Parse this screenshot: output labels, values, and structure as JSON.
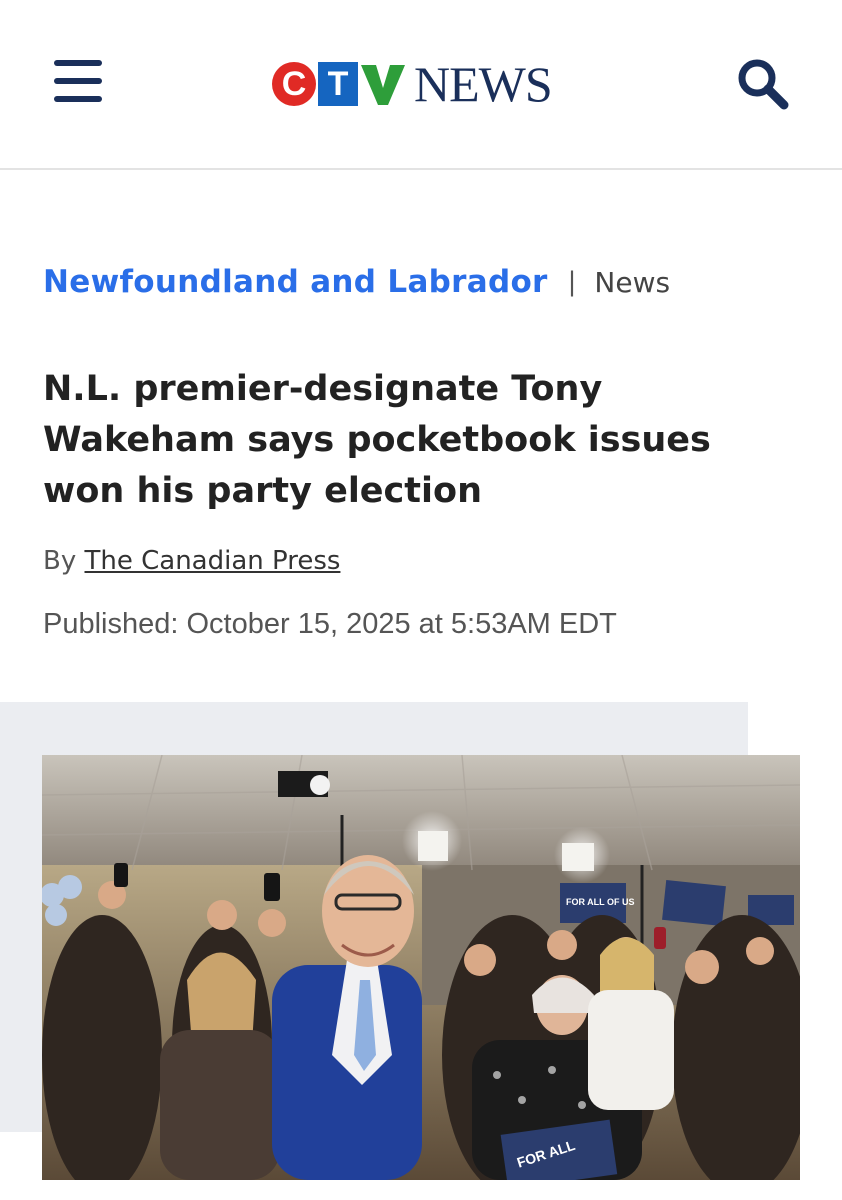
{
  "header": {
    "menu_icon": "hamburger-menu-icon",
    "logo": {
      "letters": [
        "C",
        "T",
        "V"
      ],
      "word": "NEWS",
      "colors": {
        "c": "#e02a25",
        "t": "#1565c0",
        "v": "#2e9e3a",
        "word": "#1a2f5a"
      }
    },
    "search_icon": "search-icon"
  },
  "section": {
    "region": "Newfoundland and Labrador",
    "separator": "|",
    "category": "News",
    "accent_color": "#2a6ee8"
  },
  "article": {
    "headline": "N.L. premier-designate Tony Wakeham says pocketbook issues won his party election",
    "byline_prefix": "By",
    "author": "The Canadian Press",
    "published": "Published: October 15, 2025 at 5:53AM EDT"
  },
  "photo": {
    "sign_text_1": "FOR ALL OF US",
    "sign_text_2": "FOR ALL"
  }
}
